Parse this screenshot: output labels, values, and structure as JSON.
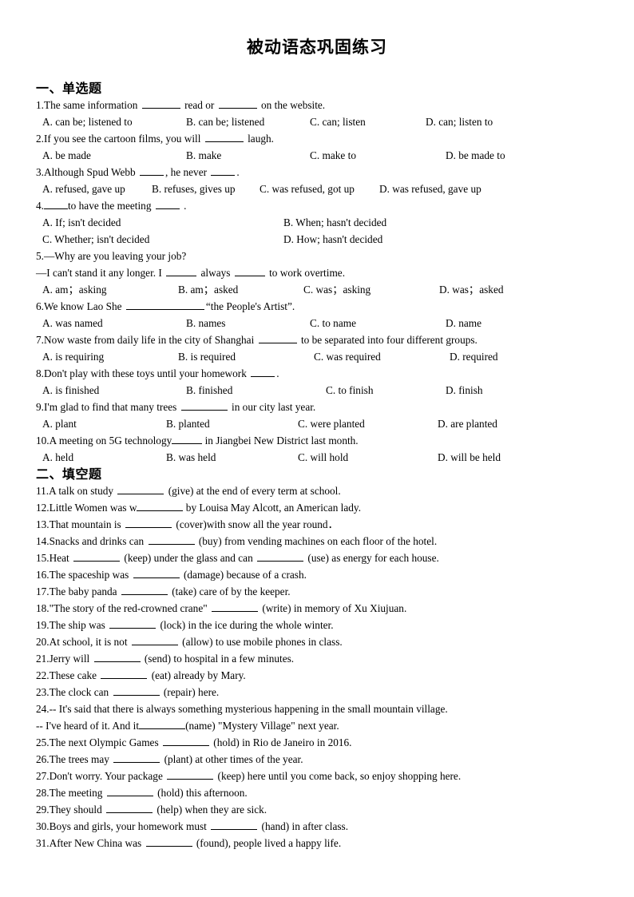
{
  "document": {
    "title": "被动语态巩固练习"
  },
  "sections": [
    {
      "heading": "一、单选题",
      "questions": [
        {
          "number": "1.",
          "text_before": "The same information",
          "text_mid": "read or",
          "text_after": "on the website.",
          "options": [
            "A. can be; listened to",
            "B. can be; listened",
            "C. can; listen",
            "D. can; listen to"
          ]
        },
        {
          "number": "2.",
          "text_before": "If you see the cartoon films, you will",
          "text_after": "laugh.",
          "options": [
            "A. be made",
            "B. make",
            "C. make to",
            "D. be made to"
          ]
        },
        {
          "number": "3.",
          "text_before": "Although Spud Webb",
          "text_mid": ", he never",
          "text_after": ".",
          "options": [
            "A. refused, gave up",
            "B. refuses, gives up",
            "C. was refused, got up",
            "D. was refused, gave up"
          ]
        },
        {
          "number": "4.",
          "text_before": "",
          "text_mid": "to have the meeting",
          "text_after": ".",
          "options": [
            "A. If; isn't decided",
            "B. When; hasn't decided",
            "C. Whether; isn't decided",
            "D. How; hasn't decided"
          ]
        },
        {
          "number": "5.",
          "stem_line1": "—Why are you leaving your job?",
          "stem_line2_before": "—I can't stand it any longer. I",
          "stem_line2_mid": "always",
          "stem_line2_after": "to work overtime.",
          "options": [
            "A. am；asking",
            "B. am；asked",
            "C. was；asking",
            "D. was；asked"
          ]
        },
        {
          "number": "6.",
          "text_before": "We know Lao She",
          "text_after": "“the People's Artist”.",
          "options": [
            "A. was named",
            "B. names",
            "C. to name",
            "D. name"
          ]
        },
        {
          "number": "7.",
          "text_before": "Now waste from daily life in the city of Shanghai",
          "text_after": "to be separated into four different groups.",
          "options": [
            "A. is requiring",
            "B. is required",
            "C. was required",
            "D. required"
          ]
        },
        {
          "number": "8.",
          "text_before": "Don't play with these toys until your homework",
          "text_after": ".",
          "options": [
            "A. is finished",
            "B. finished",
            "C. to finish",
            "D. finish"
          ]
        },
        {
          "number": "9.",
          "text_before": "I'm glad to find that many trees",
          "text_after": "in our city last year.",
          "options": [
            "A. plant",
            "B. planted",
            "C. were planted",
            "D. are planted"
          ]
        },
        {
          "number": "10.",
          "text_before": "A meeting on 5G technology",
          "text_after": "in Jiangbei New District last month.",
          "options": [
            "A. held",
            "B. was held",
            "C. will hold",
            "D. will be held"
          ]
        }
      ]
    },
    {
      "heading": "二、填空题",
      "fill_questions": [
        {
          "number": "11.",
          "before": "A talk on study",
          "after": "(give) at the end of every term at school."
        },
        {
          "number": "12.",
          "before": "Little Women was w",
          "after": "by Louisa May Alcott, an American lady.",
          "tight": true
        },
        {
          "number": "13.",
          "before": "That mountain is",
          "after": "(cover)with snow all the year round．"
        },
        {
          "number": "14.",
          "before": "Snacks and drinks can",
          "after": "(buy) from vending machines on each floor of the hotel."
        },
        {
          "number": "15.",
          "before": "Heat",
          "mid": "(keep) under the glass and can",
          "after": "(use) as energy for each house."
        },
        {
          "number": "16.",
          "before": "The spaceship was",
          "after": "(damage) because of a crash."
        },
        {
          "number": "17.",
          "before": "The baby panda",
          "after": "(take) care of by the keeper."
        },
        {
          "number": "18.",
          "before": "\"The story of the red-crowned crane\"",
          "after": "(write) in memory of Xu Xiujuan."
        },
        {
          "number": "19.",
          "before": "The ship was",
          "after": "(lock) in the ice during the whole winter."
        },
        {
          "number": "20.",
          "before": "At school, it is not",
          "after": "(allow) to use mobile phones in class."
        },
        {
          "number": "21.",
          "before": "Jerry will",
          "after": "(send) to hospital in a few minutes."
        },
        {
          "number": "22.",
          "before": "These cake",
          "after": "(eat) already by Mary."
        },
        {
          "number": "23.",
          "before": "The clock can",
          "after": "(repair) here."
        },
        {
          "number": "24.",
          "line1": "-- It's said that there is always something mysterious happening in the small mountain village.",
          "line2_before": "-- I've heard of it. And it",
          "line2_after": "(name) \"Mystery Village\" next year.",
          "tight": true
        },
        {
          "number": "25.",
          "before": "The next Olympic Games",
          "after": "(hold) in Rio de Janeiro in 2016."
        },
        {
          "number": "26.",
          "before": "The trees may",
          "after": "(plant) at other times of the year."
        },
        {
          "number": "27.",
          "before": "Don't worry. Your package",
          "after": "(keep) here until you come back, so enjoy shopping here."
        },
        {
          "number": "28.",
          "before": "The meeting",
          "after": "(hold) this afternoon."
        },
        {
          "number": "29.",
          "before": "They should",
          "after": "(help) when they are sick."
        },
        {
          "number": "30.",
          "before": "Boys and girls, your homework must",
          "after": "(hand) in after class."
        },
        {
          "number": "31.",
          "before": "After New China was",
          "after": "(found), people lived a happy life."
        }
      ]
    }
  ]
}
